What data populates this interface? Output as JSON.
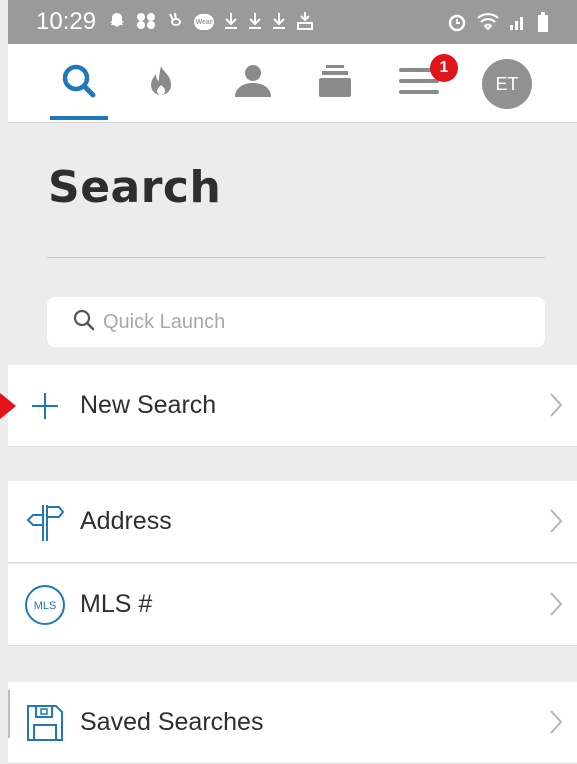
{
  "status_bar": {
    "time": "10:29",
    "wear_label": "Wear",
    "icons": [
      "snapchat-icon",
      "app-icon",
      "rabbit-icon",
      "wear-icon",
      "download-icon",
      "download-icon",
      "download-icon",
      "cloud-download-icon",
      "alarm-icon",
      "wifi-icon",
      "signal-icon",
      "battery-icon"
    ]
  },
  "nav": {
    "active_color": "#1f78b9",
    "icon_color": "#8a8a8a",
    "items": [
      "search-icon",
      "hot-icon",
      "person-icon",
      "stack-icon",
      "menu-icon"
    ],
    "notification_count": "1",
    "avatar_initials": "ET"
  },
  "page": {
    "title": "Search"
  },
  "search": {
    "placeholder": "Quick Launch"
  },
  "list": {
    "new_search": "New Search",
    "address": "Address",
    "mls_label": "MLS #",
    "mls_icon_text": "MLS",
    "saved_searches": "Saved Searches"
  }
}
